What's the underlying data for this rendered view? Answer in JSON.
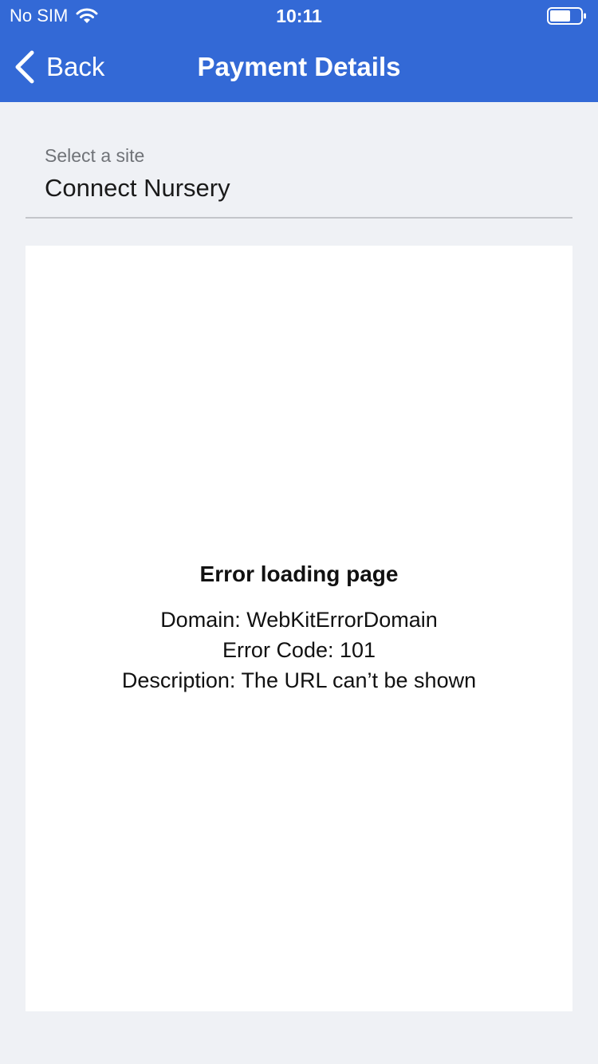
{
  "status_bar": {
    "carrier": "No SIM",
    "time": "10:11",
    "icons": [
      "wifi-icon",
      "battery-icon"
    ]
  },
  "nav": {
    "back_label": "Back",
    "back_icon": "chevron-left-icon",
    "title": "Payment Details"
  },
  "site_selector": {
    "label": "Select a site",
    "value": "Connect Nursery"
  },
  "webview": {
    "error_title": "Error loading page",
    "domain_line": "Domain: WebKitErrorDomain",
    "code_line": "Error Code: 101",
    "description_line": "Description: The URL can’t be shown"
  },
  "colors": {
    "header_bg": "#3369d6",
    "page_bg": "#eff1f5",
    "webview_bg": "#ffffff"
  }
}
